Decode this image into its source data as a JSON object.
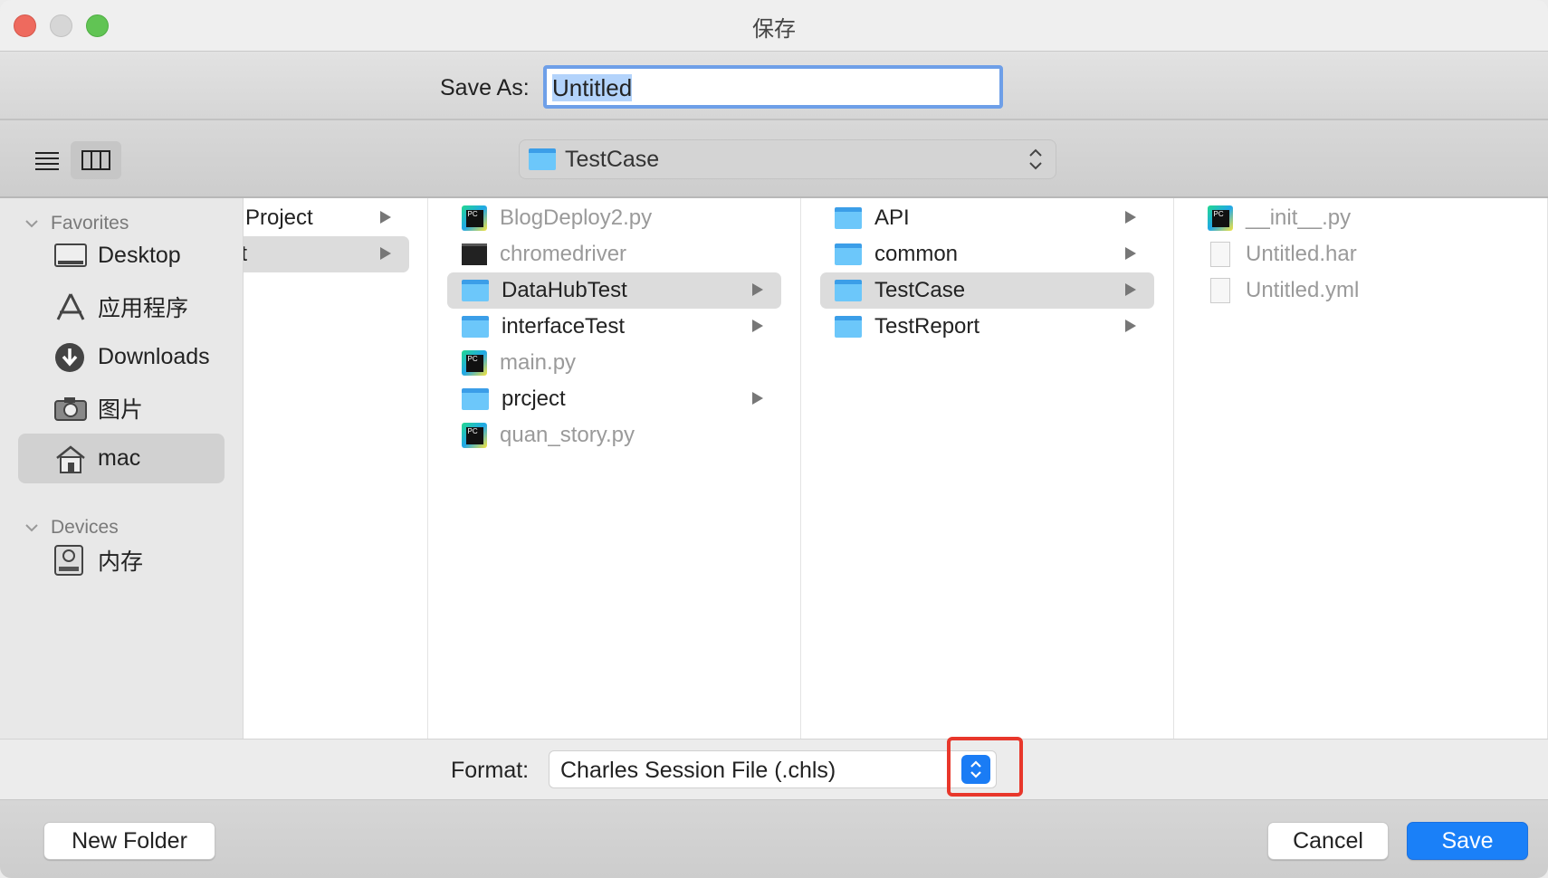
{
  "window": {
    "title": "保存"
  },
  "save_as": {
    "label": "Save As:",
    "value": "Untitled"
  },
  "toolbar": {
    "view_list": "list-view",
    "view_columns": "column-view",
    "path_popup": "TestCase"
  },
  "sidebar": {
    "favorites_label": "Favorites",
    "favorites": [
      {
        "label": "Desktop",
        "icon": "desktop-icon"
      },
      {
        "label": "应用程序",
        "icon": "applications-icon"
      },
      {
        "label": "Downloads",
        "icon": "downloads-icon"
      },
      {
        "label": "图片",
        "icon": "camera-icon"
      },
      {
        "label": "mac",
        "icon": "home-icon",
        "selected": true
      }
    ],
    "devices_label": "Devices",
    "devices": [
      {
        "label": "内存",
        "icon": "disk-icon"
      }
    ]
  },
  "columns": [
    [
      {
        "label": "Project",
        "folder": true,
        "kind": "none"
      },
      {
        "label": "ect",
        "folder": true,
        "kind": "none",
        "selected": true
      }
    ],
    [
      {
        "label": "BlogDeploy2.py",
        "kind": "pycharm",
        "dim": true
      },
      {
        "label": "chromedriver",
        "kind": "exec",
        "dim": true
      },
      {
        "label": "DataHubTest",
        "kind": "folder",
        "folder": true,
        "selected": true
      },
      {
        "label": "interfaceTest",
        "kind": "folder",
        "folder": true
      },
      {
        "label": "main.py",
        "kind": "pycharm",
        "dim": true
      },
      {
        "label": "prcject",
        "kind": "folder",
        "folder": true
      },
      {
        "label": "quan_story.py",
        "kind": "pycharm",
        "dim": true
      }
    ],
    [
      {
        "label": "API",
        "kind": "folder",
        "folder": true
      },
      {
        "label": "common",
        "kind": "folder",
        "folder": true
      },
      {
        "label": "TestCase",
        "kind": "folder",
        "folder": true,
        "selected": true
      },
      {
        "label": "TestReport",
        "kind": "folder",
        "folder": true
      }
    ],
    [
      {
        "label": "__init__.py",
        "kind": "pycharm",
        "dim": true
      },
      {
        "label": "Untitled.har",
        "kind": "doc",
        "dim": true
      },
      {
        "label": "Untitled.yml",
        "kind": "doc",
        "dim": true
      }
    ]
  ],
  "format": {
    "label": "Format:",
    "value": "Charles Session File (.chls)"
  },
  "buttons": {
    "new_folder": "New Folder",
    "cancel": "Cancel",
    "save": "Save"
  },
  "colors": {
    "accent": "#1a80f8",
    "highlight": "#e8372b"
  }
}
